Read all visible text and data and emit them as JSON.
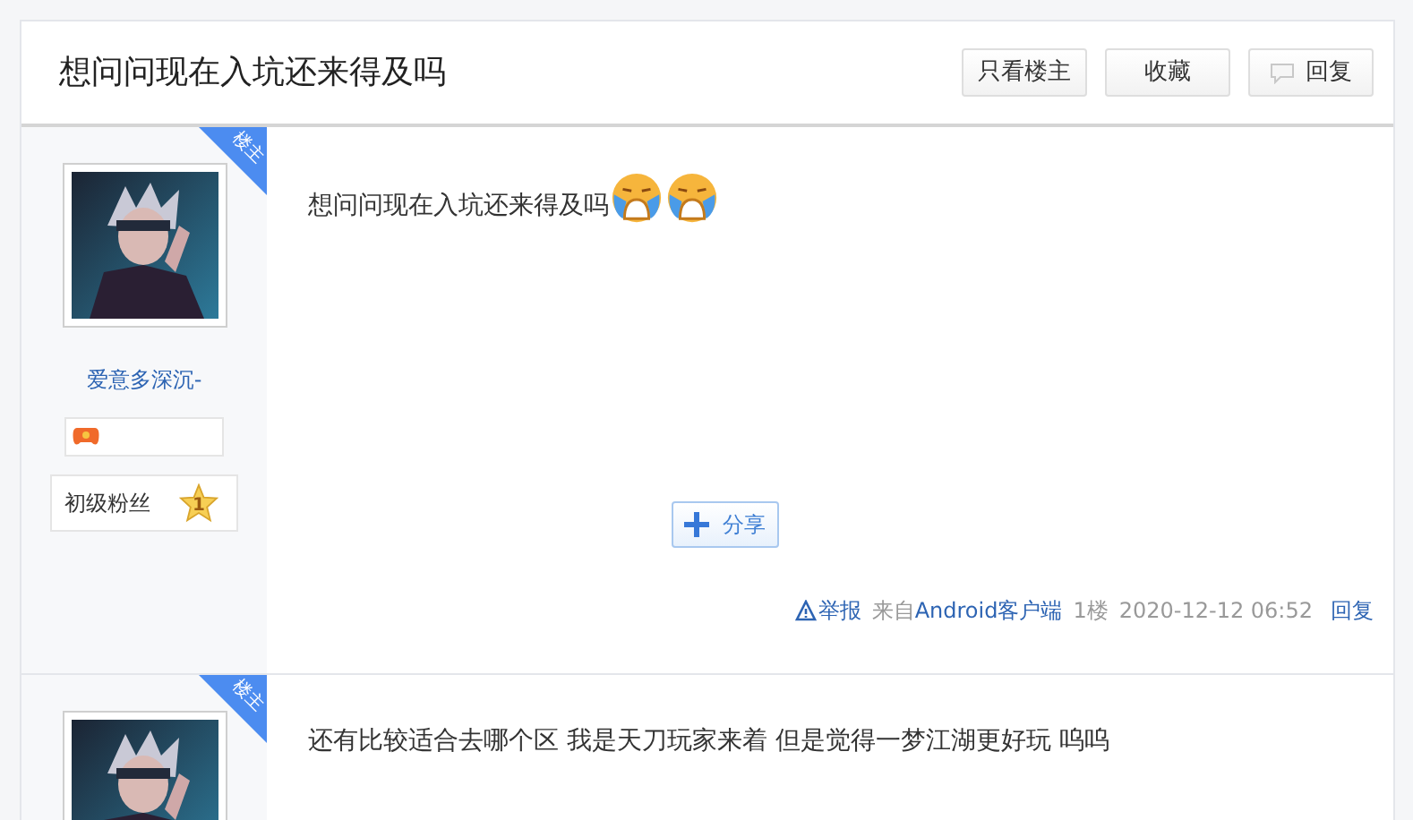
{
  "thread_title": "想问问现在入坑还来得及吗",
  "buttons": [
    {
      "label": "只看楼主",
      "kind": "plain"
    },
    {
      "label": "收藏",
      "kind": "plain"
    },
    {
      "label": "回复",
      "kind": "reply"
    }
  ],
  "posts": [
    {
      "corner_badge": "楼主",
      "username": "爱意多深沉-",
      "badge_icons": [
        {
          "kind": "game"
        }
      ],
      "fan_level": {
        "label": "初级粉丝",
        "number": "1"
      },
      "content": "想问问现在入坑还来得及吗",
      "emojis": [
        {
          "kind": "crying"
        },
        {
          "kind": "crying"
        }
      ],
      "share": "分享",
      "footer": {
        "report": "举报",
        "source_prefix": "来自",
        "source": "Android客户端",
        "floor": "1楼",
        "time": "2020-12-12 06:52",
        "reply": "回复"
      }
    },
    {
      "corner_badge": "楼主",
      "content": "还有比较适合去哪个区 我是天刀玩家来着 但是觉得一梦江湖更好玩 呜呜"
    }
  ]
}
